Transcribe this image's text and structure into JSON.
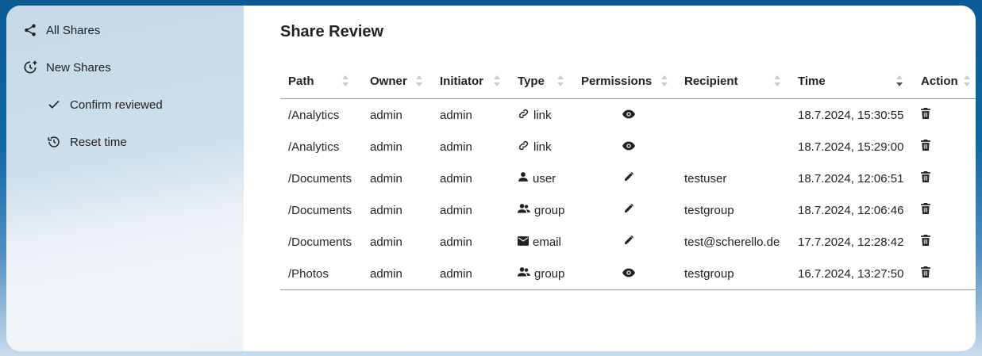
{
  "sidebar": {
    "items": [
      {
        "label": "All Shares",
        "icon": "share-icon"
      },
      {
        "label": "New Shares",
        "icon": "clock-plus-icon"
      },
      {
        "label": "Confirm reviewed",
        "icon": "check-icon"
      },
      {
        "label": "Reset time",
        "icon": "history-icon"
      }
    ]
  },
  "main": {
    "title": "Share Review",
    "columns": [
      "Path",
      "Owner",
      "Initiator",
      "Type",
      "Permissions",
      "Recipient",
      "Time",
      "Action"
    ],
    "sorted_column": "Time",
    "rows": [
      {
        "path": "/Analytics",
        "owner": "admin",
        "initiator": "admin",
        "type": "link",
        "type_icon": "link-icon",
        "permission": "view-icon",
        "recipient": "",
        "time": "18.7.2024, 15:30:55"
      },
      {
        "path": "/Analytics",
        "owner": "admin",
        "initiator": "admin",
        "type": "link",
        "type_icon": "link-icon",
        "permission": "view-icon",
        "recipient": "",
        "time": "18.7.2024, 15:29:00"
      },
      {
        "path": "/Documents",
        "owner": "admin",
        "initiator": "admin",
        "type": "user",
        "type_icon": "user-icon",
        "permission": "edit-icon",
        "recipient": "testuser",
        "time": "18.7.2024, 12:06:51"
      },
      {
        "path": "/Documents",
        "owner": "admin",
        "initiator": "admin",
        "type": "group",
        "type_icon": "group-icon",
        "permission": "edit-icon",
        "recipient": "testgroup",
        "time": "18.7.2024, 12:06:46"
      },
      {
        "path": "/Documents",
        "owner": "admin",
        "initiator": "admin",
        "type": "email",
        "type_icon": "email-icon",
        "permission": "edit-icon",
        "recipient": "test@scherello.de",
        "time": "17.7.2024, 12:28:42"
      },
      {
        "path": "/Photos",
        "owner": "admin",
        "initiator": "admin",
        "type": "group",
        "type_icon": "group-icon",
        "permission": "view-icon",
        "recipient": "testgroup",
        "time": "16.7.2024, 13:27:50"
      }
    ]
  }
}
